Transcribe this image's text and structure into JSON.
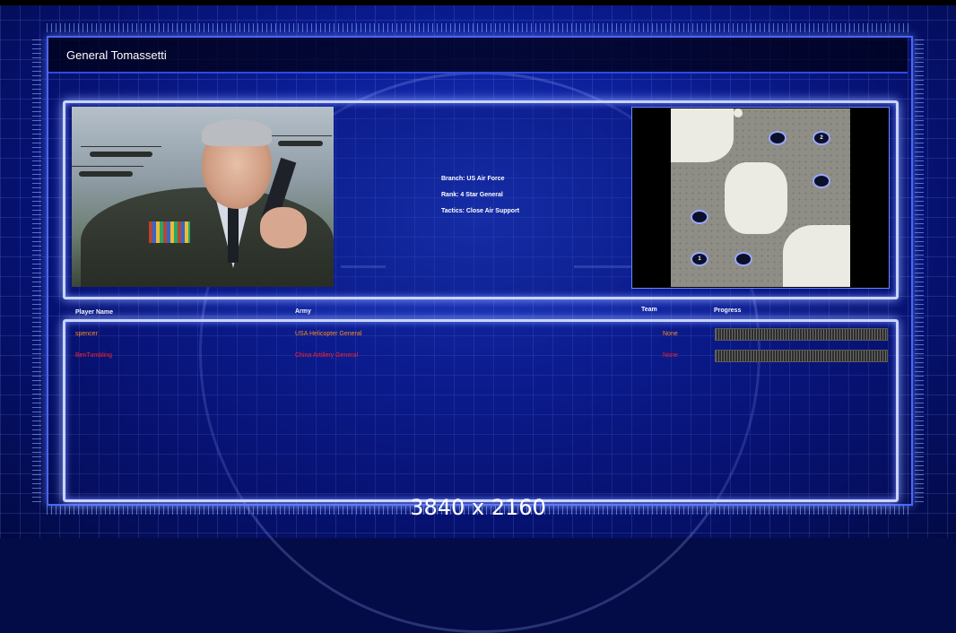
{
  "screen": {
    "title": "General Tomassetti",
    "watermark": "3840 x 2160"
  },
  "general": {
    "branch": "Branch: US Air Force",
    "rank": "Rank: 4 Star General",
    "tactics": "Tactics: Close Air Support"
  },
  "map": {
    "spots": [
      "2",
      "1",
      "",
      "",
      "",
      ""
    ]
  },
  "table": {
    "headers": {
      "player": "Player Name",
      "army": "Army",
      "team": "Team",
      "progress": "Progress"
    },
    "rows": [
      {
        "player": "spencer",
        "army": "USA Helicopter General",
        "team": "None",
        "color": "#ff8a1a",
        "progress": 0.0
      },
      {
        "player": "BenTumbling",
        "army": "China Artillery General",
        "team": "None",
        "color": "#ff2020",
        "progress": 0.0
      }
    ]
  }
}
